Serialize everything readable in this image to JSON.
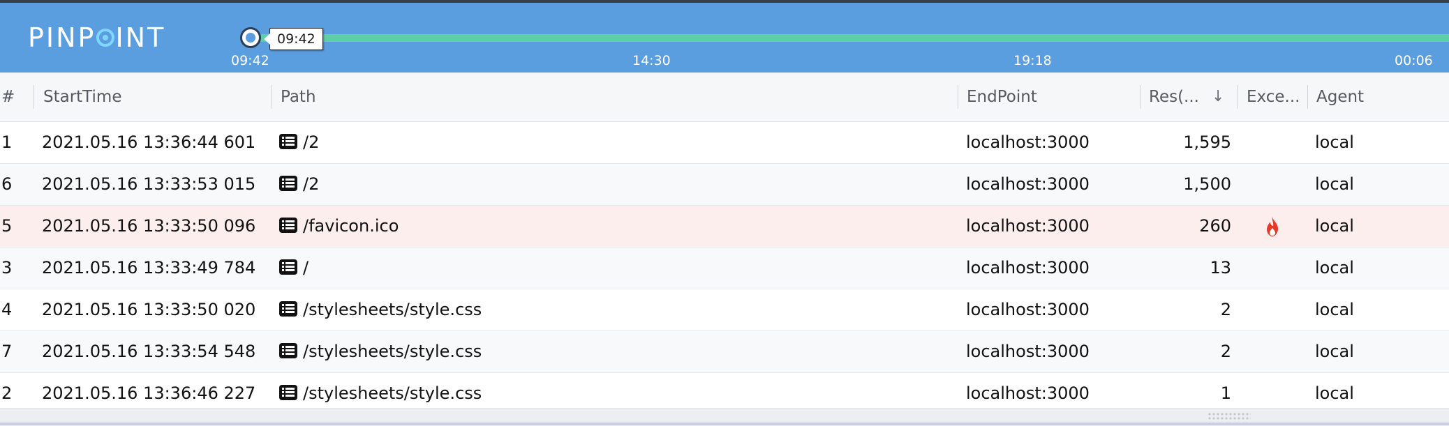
{
  "app": {
    "logo_text_before": "PINP",
    "logo_text_after": "INT"
  },
  "timeline": {
    "handle_label": "09:42",
    "ticks": [
      "09:42",
      "14:30",
      "19:18",
      "00:06"
    ],
    "colors": {
      "header_bg": "#5b9ee0",
      "track": "#5dcfa6"
    }
  },
  "table": {
    "columns": {
      "index": "#",
      "start_time": "StartTime",
      "path": "Path",
      "endpoint": "EndPoint",
      "response": "Res(...",
      "exception": "Exce...",
      "agent": "Agent"
    },
    "sort": {
      "column": "response",
      "direction": "descending",
      "icon": "arrow-down-icon"
    },
    "rows": [
      {
        "index": "1",
        "start_time": "2021.05.16 13:36:44 601",
        "path": "/2",
        "endpoint": "localhost:3000",
        "response": "1,595",
        "exception": false,
        "agent": "local"
      },
      {
        "index": "6",
        "start_time": "2021.05.16 13:33:53 015",
        "path": "/2",
        "endpoint": "localhost:3000",
        "response": "1,500",
        "exception": false,
        "agent": "local"
      },
      {
        "index": "5",
        "start_time": "2021.05.16 13:33:50 096",
        "path": "/favicon.ico",
        "endpoint": "localhost:3000",
        "response": "260",
        "exception": true,
        "agent": "local"
      },
      {
        "index": "3",
        "start_time": "2021.05.16 13:33:49 784",
        "path": "/",
        "endpoint": "localhost:3000",
        "response": "13",
        "exception": false,
        "agent": "local"
      },
      {
        "index": "4",
        "start_time": "2021.05.16 13:33:50 020",
        "path": "/stylesheets/style.css",
        "endpoint": "localhost:3000",
        "response": "2",
        "exception": false,
        "agent": "local"
      },
      {
        "index": "7",
        "start_time": "2021.05.16 13:33:54 548",
        "path": "/stylesheets/style.css",
        "endpoint": "localhost:3000",
        "response": "2",
        "exception": false,
        "agent": "local"
      },
      {
        "index": "2",
        "start_time": "2021.05.16 13:36:46 227",
        "path": "/stylesheets/style.css",
        "endpoint": "localhost:3000",
        "response": "1",
        "exception": false,
        "agent": "local"
      }
    ],
    "colors": {
      "error_row": "#fdeeee",
      "exception_icon": "#e53b2c"
    }
  }
}
